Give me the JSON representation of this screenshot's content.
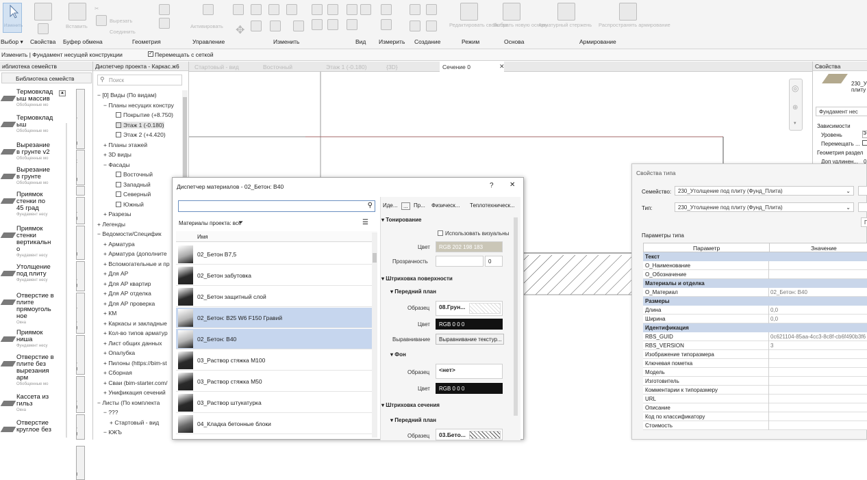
{
  "ribbon": {
    "faint": {
      "modify": "Изменить",
      "paste": "Вставить",
      "cut": "Вырезать",
      "join": "Соединить",
      "activate": "Активировать",
      "edit_family": "Редактировать свойства",
      "pick_host": "Выбрать новую основу",
      "rebar": "Арматурный стержень",
      "distribute": "Распространять армирование"
    },
    "panels": [
      "Выбор ▾",
      "Свойства",
      "Буфер обмена",
      "Геометрия",
      "Управление",
      "Изменить",
      "Вид",
      "Измерить",
      "Создание",
      "Режим",
      "Основа",
      "Армирование"
    ]
  },
  "optbar": {
    "context": "Изменить | Фундамент несущей конструкции",
    "move_with_grid_label": "Перемещать с сеткой",
    "move_with_grid": true
  },
  "family_browser": {
    "header": "иблиотека семейств",
    "tab_label": "Библиотека семейств",
    "items": [
      {
        "name": "Термовклад\nыш массив",
        "sub": "Обобщенные мо"
      },
      {
        "name": "Термовклад\nыш",
        "sub": "Обобщенные мо"
      },
      {
        "name": "Вырезание\nв грунте v2",
        "sub": "Обобщенные мо"
      },
      {
        "name": "Вырезание\nв грунте",
        "sub": "Обобщенные мо"
      },
      {
        "name": "Приямок\nстенки по\n45 град",
        "sub": "Фундамент несу"
      },
      {
        "name": "Приямок\nстенки\nвертикальн\nо",
        "sub": "Фундамент несу"
      },
      {
        "name": "Утолщение\nпод плиту",
        "sub": "Фундамент несу"
      },
      {
        "name": "Отверстие в\nплите\nпрямоуголь\nное",
        "sub": "Окна"
      },
      {
        "name": "Приямок\nниша",
        "sub": "Фундамент несу"
      },
      {
        "name": "Отверстие в\nплите без\nвырезания\nарм",
        "sub": "Обобщенные мо"
      },
      {
        "name": "Кассета из\nгильз",
        "sub": "Окна"
      },
      {
        "name": "Отверстие\nкруглое без",
        "sub": ""
      }
    ],
    "vertical_tabs": [
      "1_ЖБКонстр",
      "2_Закладные",
      "2D",
      "3_Проемы",
      "4_Металл",
      "6_Арм выш",
      "6_Арм каркас",
      "6_Арм плит",
      "6_Арм стен",
      "6_Арм IFC",
      "7_Узлы КМ"
    ]
  },
  "project_browser": {
    "header": "Диспетчер проекта - Каркас.ж6",
    "search_placeholder": "Поиск",
    "tree": [
      {
        "text": "−  [0] Виды (По видам)",
        "depth": 0
      },
      {
        "text": "−  Планы несущих констру",
        "depth": 1
      },
      {
        "text": "Покрытие (+8.750)",
        "depth": 3
      },
      {
        "text": "Этаж 1 (-0.180)",
        "depth": 3
      },
      {
        "text": "Этаж 2 (+4.420)",
        "depth": 3
      },
      {
        "text": "+  Планы этажей",
        "depth": 1
      },
      {
        "text": "+  3D виды",
        "depth": 1
      },
      {
        "text": "−  Фасады",
        "depth": 1
      },
      {
        "text": "Восточный",
        "depth": 3
      },
      {
        "text": "Западный",
        "depth": 3
      },
      {
        "text": "Северный",
        "depth": 3
      },
      {
        "text": "Южный",
        "depth": 3
      },
      {
        "text": "+  Разрезы",
        "depth": 1
      },
      {
        "text": "+  Легенды",
        "depth": 0
      },
      {
        "text": "−  Ведомости/Специфик",
        "depth": 0
      },
      {
        "text": "+  Арматура",
        "depth": 1
      },
      {
        "text": "+  Арматура (дополните",
        "depth": 1
      },
      {
        "text": "+  Вспомогательные и пр",
        "depth": 1
      },
      {
        "text": "+  Для АР",
        "depth": 1
      },
      {
        "text": "+  Для АР квартир",
        "depth": 1
      },
      {
        "text": "+  Для АР отделка",
        "depth": 1
      },
      {
        "text": "+  Для АР проверка",
        "depth": 1
      },
      {
        "text": "+  КМ",
        "depth": 1
      },
      {
        "text": "+  Каркасы и закладные",
        "depth": 1
      },
      {
        "text": "+  Кол-во типов арматур",
        "depth": 1
      },
      {
        "text": "+  Лист общих данных",
        "depth": 1
      },
      {
        "text": "+  Опалубка",
        "depth": 1
      },
      {
        "text": "+  Пилоны (https://bim-st",
        "depth": 1
      },
      {
        "text": "+  Сборная",
        "depth": 1
      },
      {
        "text": "+  Сваи (bim-starter.com/",
        "depth": 1
      },
      {
        "text": "+  Унификация сечений",
        "depth": 1
      },
      {
        "text": "−  Листы (По комплекта",
        "depth": 0
      },
      {
        "text": "−  ???",
        "depth": 1
      },
      {
        "text": "+  Стартовый - вид",
        "depth": 2
      },
      {
        "text": "−  КЖЪ",
        "depth": 1
      }
    ]
  },
  "view_tabs": [
    {
      "label": "Стартовый - вид",
      "active": false
    },
    {
      "label": "Восточный",
      "active": false
    },
    {
      "label": "Этаж 1 (-0.180)",
      "active": false
    },
    {
      "label": "{3D}",
      "active": false
    },
    {
      "label": "Сечение 0",
      "active": true
    }
  ],
  "properties": {
    "header": "Свойства",
    "type_preview": "230_У\nплиту",
    "type_selector": "Фундамент нес",
    "constraints": "Зависимости",
    "level": "Уровень",
    "level_val": "Э",
    "move": "Перемещать ...",
    "split_geom": "Геометрия раздел",
    "extra": "Доп удлинен...",
    "extra_val": "0"
  },
  "type_props": {
    "title": "Свойства типа",
    "family_label": "Семейство:",
    "family_value": "230_Утолщение под плиту (Фунд_Плита)",
    "type_label": "Тип:",
    "type_value": "230_Утолщение под плиту (Фунд_Плита)",
    "p_button": "П",
    "params_label": "Параметры типа",
    "col_param": "Параметр",
    "col_value": "Значение",
    "rows": [
      {
        "kind": "sec",
        "p": "Текст",
        "v": ""
      },
      {
        "kind": "row",
        "p": "О_Наименование",
        "v": ""
      },
      {
        "kind": "row",
        "p": "О_Обозначение",
        "v": ""
      },
      {
        "kind": "sec",
        "p": "Материалы и отделка",
        "v": ""
      },
      {
        "kind": "row",
        "p": "О_Материал",
        "v": "02_Бетон: В40"
      },
      {
        "kind": "sec",
        "p": "Размеры",
        "v": ""
      },
      {
        "kind": "row",
        "p": "Длина",
        "v": "0,0"
      },
      {
        "kind": "row",
        "p": "Ширина",
        "v": "0,0"
      },
      {
        "kind": "sec",
        "p": "Идентификация",
        "v": ""
      },
      {
        "kind": "row",
        "p": "RBS_GUID",
        "v": "0c621104-85aa-4cc3-8c8f-cb6f490b3f6"
      },
      {
        "kind": "row",
        "p": "RBS_VERSION",
        "v": "3"
      },
      {
        "kind": "row",
        "p": "Изображение типоразмера",
        "v": ""
      },
      {
        "kind": "row",
        "p": "Ключевая пометка",
        "v": ""
      },
      {
        "kind": "row",
        "p": "Модель",
        "v": ""
      },
      {
        "kind": "row",
        "p": "Изготовитель",
        "v": ""
      },
      {
        "kind": "row",
        "p": "Комментарии к типоразмеру",
        "v": ""
      },
      {
        "kind": "row",
        "p": "URL",
        "v": ""
      },
      {
        "kind": "row",
        "p": "Описание",
        "v": ""
      },
      {
        "kind": "row",
        "p": "Код по классификатору",
        "v": ""
      },
      {
        "kind": "row",
        "p": "Стоимость",
        "v": ""
      }
    ]
  },
  "material_dialog": {
    "title": "Диспетчер материалов - 02_Бетон: В40",
    "help": "?",
    "close": "✕",
    "search_value": "",
    "filter_label": "Материалы проекта: все",
    "col_name": "Имя",
    "materials": [
      {
        "name": "02_Бетон В7,5",
        "swatch": "#aaaaaa",
        "selected": false
      },
      {
        "name": "02_Бетон забутовка",
        "swatch": "#2a2a2a",
        "selected": false
      },
      {
        "name": "02_Бетон защитный слой",
        "swatch": "#2a2a2a",
        "selected": false
      },
      {
        "name": "02_Бетон: В25 W6 F150 Гравий",
        "swatch": "#b5b5b5",
        "selected": true
      },
      {
        "name": "02_Бетон: В40",
        "swatch": "#b5b5b5",
        "selected": true
      },
      {
        "name": "03_Раствор стяжка М100",
        "swatch": "#2a2a2a",
        "selected": false
      },
      {
        "name": "03_Раствор стяжка М50",
        "swatch": "#2a2a2a",
        "selected": false
      },
      {
        "name": "03_Раствор штукатурка",
        "swatch": "#2a2a2a",
        "selected": false
      },
      {
        "name": "04_Кладка бетонные блоки",
        "swatch": "#6a6a6a",
        "selected": false
      }
    ],
    "tabs": [
      "Иде...",
      "...",
      "Пр...",
      "Физическ...",
      "Теплотехническ..."
    ],
    "shading": {
      "header": "▾ Тонирование",
      "use_render_label": "Использовать визуальны",
      "use_render": false,
      "color_label": "Цвет",
      "color_value": "RGB 202 198 183",
      "color_hex": "#cac6b7",
      "transparency_label": "Прозрачность",
      "transparency_value": "0"
    },
    "surface": {
      "header": "▾ Штриховка поверхности",
      "foreground": "▾ Передний план",
      "pattern_label": "Образец",
      "pattern_value": "08.Грун...",
      "color_label": "Цвет",
      "color_value": "RGB 0 0 0",
      "align_label": "Выравнивание",
      "align_value": "Выравнивание текстур...",
      "background": "▾ Фон",
      "bg_pattern_value": "<нет>",
      "bg_color_value": "RGB 0 0 0"
    },
    "cut": {
      "header": "▾ Штриховка сечения",
      "foreground": "▾ Передний план",
      "pattern_label": "Образец",
      "pattern_value": "03.Бето..."
    }
  }
}
